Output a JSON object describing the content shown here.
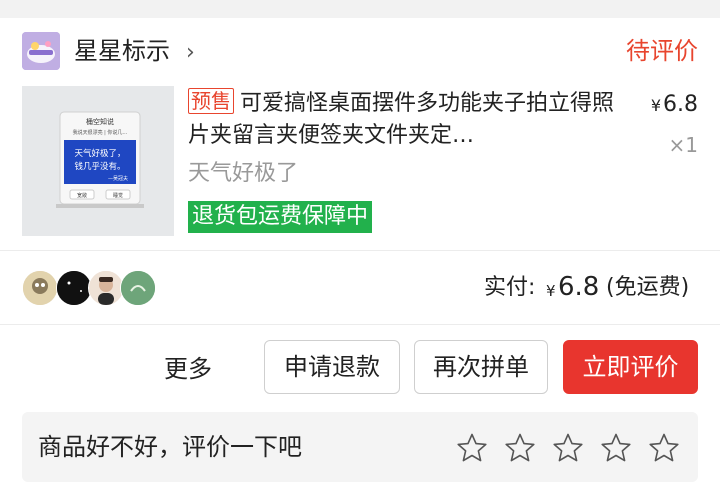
{
  "shop": {
    "name": "星星标示",
    "logo_icon": "shop-logo-icon",
    "chevron": "›"
  },
  "order": {
    "status": "待评价"
  },
  "product": {
    "presale_tag": "预售",
    "title": "可爱搞怪桌面摆件多功能夹子拍立得照片夹留言夹便签夹文件夹定…",
    "price_symbol": "¥",
    "price": "6.8",
    "quantity": "×1",
    "sku": "天气好极了",
    "guarantee": "退货包运费保障中",
    "thumb": {
      "header": "桶空知说",
      "sub": "我说天很漂亮 | 你说几…",
      "quote": "天气好极了，\n钱几乎没有。",
      "author": "—吴冠夫",
      "btn_left": "宽敞",
      "btn_right": "睡觉"
    }
  },
  "payment": {
    "label": "实付:",
    "currency": "¥",
    "amount": "6.8",
    "note": "(免运费)"
  },
  "group_avatars": [
    "avatar-cartoon",
    "avatar-dark",
    "avatar-person",
    "avatar-green"
  ],
  "actions": {
    "more": "更多",
    "refund": "申请退款",
    "regroup": "再次拼单",
    "review_now": "立即评价"
  },
  "review": {
    "prompt": "商品好不好，评价一下吧",
    "max_stars": 5,
    "rating": 0
  },
  "colors": {
    "accent": "#e8452e",
    "primary_button": "#e8352e",
    "guarantee_green": "#22b14c",
    "muted_text": "#999999"
  }
}
